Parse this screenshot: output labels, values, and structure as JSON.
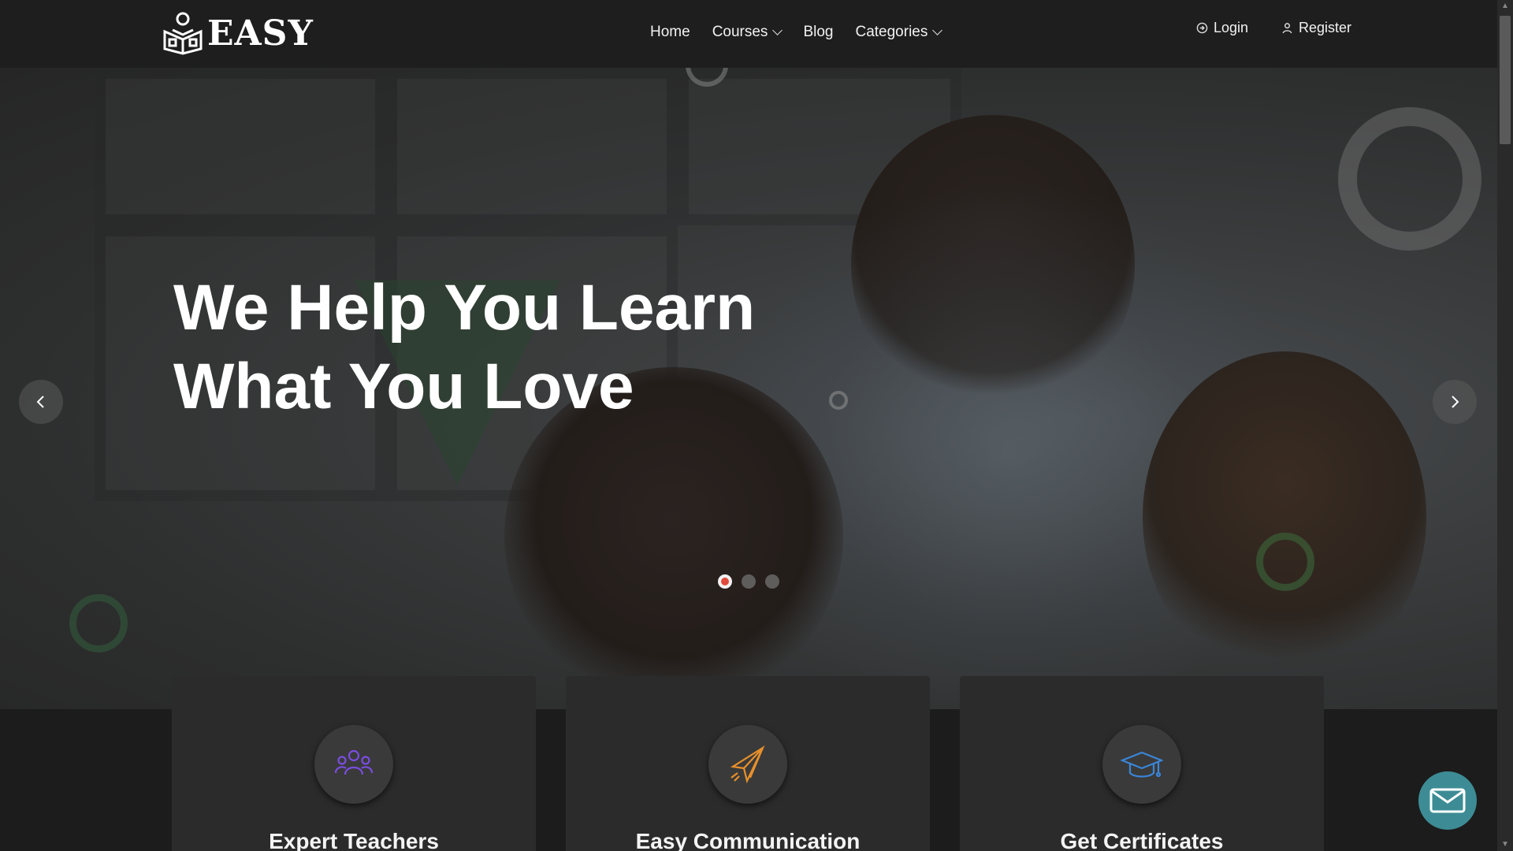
{
  "header": {
    "logo_text": "EASY",
    "nav": [
      {
        "label": "Home",
        "dropdown": false
      },
      {
        "label": "Courses",
        "dropdown": true
      },
      {
        "label": "Blog",
        "dropdown": false
      },
      {
        "label": "Categories",
        "dropdown": true
      }
    ],
    "login_label": "Login",
    "register_label": "Register"
  },
  "hero": {
    "title_line1": "We Help You Learn",
    "title_line2": "What You Love",
    "slides": 3,
    "active_slide": 1
  },
  "features": [
    {
      "title": "Expert Teachers",
      "icon": "people-group-icon",
      "color": "#7a4de0"
    },
    {
      "title": "Easy Communication",
      "icon": "paper-plane-icon",
      "color": "#e8902a"
    },
    {
      "title": "Get Certificates",
      "icon": "graduation-cap-icon",
      "color": "#3a86d8"
    }
  ],
  "colors": {
    "active_dot": "#e14b3b",
    "mail_button": "#3d8c95"
  }
}
